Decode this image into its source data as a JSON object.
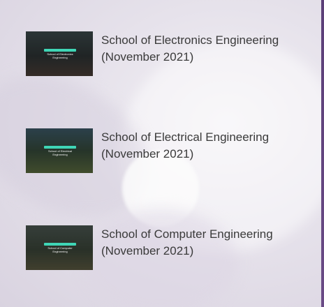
{
  "items": [
    {
      "title": "School of Electronics Engineering",
      "date": "(November 2021)",
      "caption": "School of Electronics Engineering"
    },
    {
      "title": "School of Electrical Engineering",
      "date": "(November 2021)",
      "caption": "School of Electrical Engineering"
    },
    {
      "title": "School of Computer Engineering",
      "date": "(November 2021)",
      "caption": "School of Computer Engineering"
    }
  ],
  "colors": {
    "accent": "#3fd6b6",
    "text": "#3a3a3a",
    "edge": "#5b3f78"
  }
}
